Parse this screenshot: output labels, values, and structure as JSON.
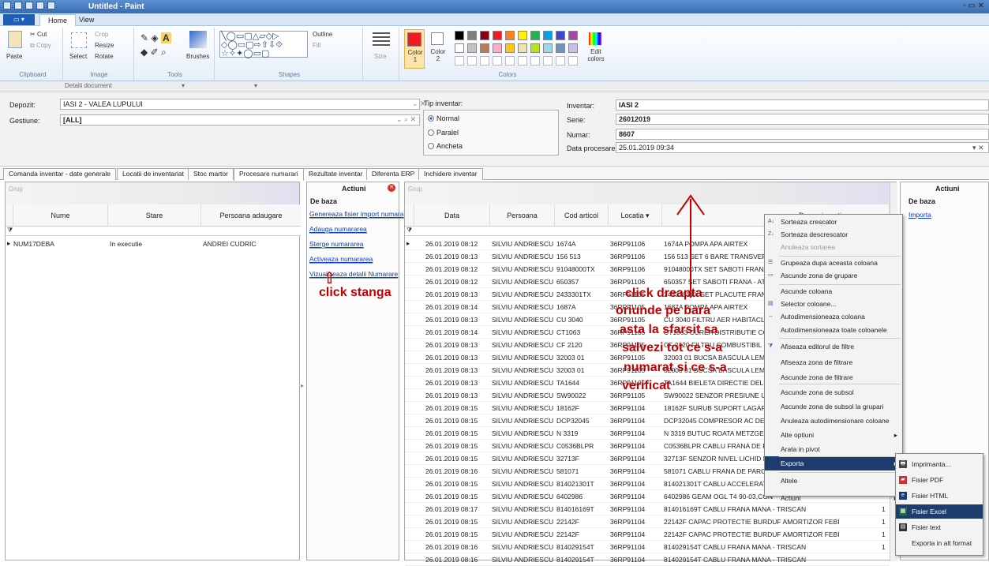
{
  "window": {
    "title": "Untitled - Paint"
  },
  "ribbon": {
    "file_tab": "▭ ▾",
    "tabs": [
      "Home",
      "View"
    ],
    "clipboard": {
      "paste": "Paste",
      "cut": "Cut",
      "copy": "Copy",
      "group": "Clipboard"
    },
    "image": {
      "select": "Select",
      "crop": "Crop",
      "resize": "Resize",
      "rotate": "Rotate",
      "group": "Image"
    },
    "tools": {
      "group": "Tools",
      "brushes": "Brushes"
    },
    "shapes": {
      "outline": "Outline",
      "fill": "Fill",
      "group": "Shapes",
      "size": "Size"
    },
    "colors": {
      "color1": "Color 1",
      "color2": "Color 2",
      "edit": "Edit colors",
      "group": "Colors",
      "row1": [
        "#000000",
        "#7f7f7f",
        "#880015",
        "#ed1c24",
        "#ff7f27",
        "#fff200",
        "#22b14c",
        "#00a2e8",
        "#3f48cc",
        "#a349a4"
      ],
      "row2": [
        "#ffffff",
        "#c3c3c3",
        "#b97a57",
        "#ffaec9",
        "#ffc90e",
        "#efe4b0",
        "#b5e61d",
        "#99d9ea",
        "#7092be",
        "#c8bfe7"
      ]
    },
    "doc_tab": "Detalii document"
  },
  "form": {
    "depozit_label": "Depozit:",
    "depozit_value": "IASI 2 - VALEA LUPULUI",
    "gestiune_label": "Gestiune:",
    "gestiune_value": "[ALL]",
    "tip_label": "Tip inventar:",
    "tip_options": [
      "Normal",
      "Paralel",
      "Ancheta"
    ],
    "inventar_label": "Inventar:",
    "inventar_value": "IASI 2",
    "serie_label": "Serie:",
    "serie_value": "26012019",
    "numar_label": "Numar:",
    "numar_value": "8607",
    "data_label": "Data procesare:",
    "data_value": "25.01.2019 09:34"
  },
  "tabs": [
    "Comanda inventar - date generale",
    "Locatii de inventariat",
    "Stoc martor",
    "Procesare numarari",
    "Rezultate inventar",
    "Diferenta ERP",
    "Inchidere inventar"
  ],
  "left_grid": {
    "group_label": "Grup",
    "columns": [
      "Nume",
      "Stare",
      "Persoana adaugare"
    ],
    "rows": [
      [
        "NUM17DEBA",
        "In executie",
        "ANDREI CUDRIC"
      ]
    ]
  },
  "actions": {
    "title": "Actiuni",
    "section": "De baza",
    "links": [
      "Genereaza fisier import numara",
      "Adauga numararea",
      "Sterge numararea",
      "Activeaza numararea",
      "Vizualizeaza detalii Numarare"
    ]
  },
  "right_grid": {
    "group_label": "Grup",
    "columns": [
      "Data",
      "Persoana",
      "Cod articol",
      "Locatia",
      "Denumire arti",
      "Cantitate"
    ],
    "rows": [
      [
        "26.01.2019 08:12",
        "SILVIU ANDRIESCU",
        "1674A",
        "36RP91106",
        "1674A POMPA APA AIRTEX"
      ],
      [
        "26.01.2019 08:13",
        "SILVIU ANDRIESCU",
        "156 513",
        "36RP91106",
        "156 513 SET 6 BARE TRANSVERSA"
      ],
      [
        "26.01.2019 08:12",
        "SILVIU ANDRIESCU",
        "91048000TX",
        "36RP91106",
        "91048000TX SET SABOTI FRANA -"
      ],
      [
        "26.01.2019 08:12",
        "SILVIU ANDRIESCU",
        "650357",
        "36RP91106",
        "650357 SET SABOTI FRANA - ATE"
      ],
      [
        "26.01.2019 08:13",
        "SILVIU ANDRIESCU",
        "2433301TX",
        "36RP91106",
        "2433301TX SET PLACUTE FRANA -"
      ],
      [
        "26.01.2019 08:14",
        "SILVIU ANDRIESCU",
        "1687A",
        "36RP91105",
        "1687A POMPA APA AIRTEX"
      ],
      [
        "26.01.2019 08:13",
        "SILVIU ANDRIESCU",
        "CU 3040",
        "36RP91105",
        "CU 3040 FILTRU AER HABITACLU -"
      ],
      [
        "26.01.2019 08:14",
        "SILVIU ANDRIESCU",
        "CT1063",
        "36RP91105",
        "CT1063 CUREA DISTRIBUTIE CONT"
      ],
      [
        "26.01.2019 08:13",
        "SILVIU ANDRIESCU",
        "CF 2120",
        "36RP91105",
        "CF 2120 FILTRU COMBUSTIBIL"
      ],
      [
        "26.01.2019 08:13",
        "SILVIU ANDRIESCU",
        "32003 01",
        "36RP91105",
        "32003 01 BUCSA BASCULA LEMFOE"
      ],
      [
        "26.01.2019 08:13",
        "SILVIU ANDRIESCU",
        "32003 01",
        "36RP91105",
        "32003 01 BUCSA BASCULA LEMFOE"
      ],
      [
        "26.01.2019 08:13",
        "SILVIU ANDRIESCU",
        "TA1644",
        "36RP91105",
        "TA1644 BIELETA DIRECTIE DELPHI"
      ],
      [
        "26.01.2019 08:13",
        "SILVIU ANDRIESCU",
        "SW90022",
        "36RP91105",
        "SW90022 SENZOR PRESIUNE ULEI"
      ],
      [
        "26.01.2019 08:15",
        "SILVIU ANDRIESCU",
        "18162F",
        "36RP91104",
        "18162F SURUB SUPORT LAGAR-AR"
      ],
      [
        "26.01.2019 08:15",
        "SILVIU ANDRIESCU",
        "DCP32045",
        "36RP91104",
        "DCP32045 COMPRESOR AC DENSO"
      ],
      [
        "26.01.2019 08:15",
        "SILVIU ANDRIESCU",
        "N 3319",
        "36RP91104",
        "N 3319 BUTUC ROATA METZGER"
      ],
      [
        "26.01.2019 08:15",
        "SILVIU ANDRIESCU",
        "C0536BLPR",
        "36RP91104",
        "C0536BLPR CABLU FRANA DE PAR"
      ],
      [
        "26.01.2019 08:15",
        "SILVIU ANDRIESCU",
        "32713F",
        "36RP91104",
        "32713F SENZOR NIVEL LICHID DE F"
      ],
      [
        "26.01.2019 08:16",
        "SILVIU ANDRIESCU",
        "581071",
        "36RP91104",
        "581071 CABLU FRANA DE PARCAR"
      ],
      [
        "26.01.2019 08:15",
        "SILVIU ANDRIESCU",
        "814021301T",
        "36RP91104",
        "814021301T CABLU ACCELERATIE"
      ],
      [
        "26.01.2019 08:15",
        "SILVIU ANDRIESCU",
        "6402986",
        "36RP91104",
        "6402986 GEAM OGL T4 90-03,CON"
      ],
      [
        "26.01.2019 08:17",
        "SILVIU ANDRIESCU",
        "814016169T",
        "36RP91104",
        "814016169T CABLU FRANA MANA - TRISCAN"
      ],
      [
        "26.01.2019 08:15",
        "SILVIU ANDRIESCU",
        "22142F",
        "36RP91104",
        "22142F CAPAC PROTECTIE BURDUF AMORTIZOR FEBI"
      ],
      [
        "26.01.2019 08:15",
        "SILVIU ANDRIESCU",
        "22142F",
        "36RP91104",
        "22142F CAPAC PROTECTIE BURDUF AMORTIZOR FEBI"
      ],
      [
        "26.01.2019 08:16",
        "SILVIU ANDRIESCU",
        "814029154T",
        "36RP91104",
        "814029154T CABLU FRANA MANA - TRISCAN"
      ],
      [
        "26.01.2019 08:16",
        "SILVIU ANDRIESCU",
        "814029154T",
        "36RP91104",
        "814029154T CABLU FRANA MANA - TRISCAN"
      ]
    ],
    "qty": {
      "21": "1",
      "22": "1",
      "23": "1",
      "24": "1"
    }
  },
  "right_actions": {
    "title": "Actiuni",
    "section": "De baza",
    "link": "Importa"
  },
  "context_menu": {
    "items": [
      "Sorteaza crescator",
      "Sorteaza descrescator",
      "Anuleaza sortarea",
      "Grupeaza dupa aceasta coloana",
      "Ascunde zona de grupare",
      "Ascunde coloana",
      "Selector coloane...",
      "Autodimensioneaza coloana",
      "Autodimensioneaza toate coloanele",
      "Afiseaza editorul de filtre",
      "Afiseaza zona de filtrare",
      "Ascunde zona de filtrare",
      "Ascunde zona de subsol",
      "Ascunde zona de subsol la grupari",
      "Anuleaza autodimensionare coloane",
      "Alte optiuni",
      "Arata in pivot",
      "Exporta",
      "Altele",
      "Actiuni"
    ]
  },
  "submenu": {
    "items": [
      "Imprimanta...",
      "Fisier PDF",
      "Fisier HTML",
      "Fisier Excel",
      "Fisier text",
      "Exporta in alt format"
    ]
  },
  "annotations": {
    "left": "click stanga",
    "right_lines": [
      "click dreapta",
      "oriunde pe bara",
      "asta la sfarsit sa",
      "salvezi tot ce s-a",
      "numarat si ce s-a",
      "verificat"
    ]
  }
}
